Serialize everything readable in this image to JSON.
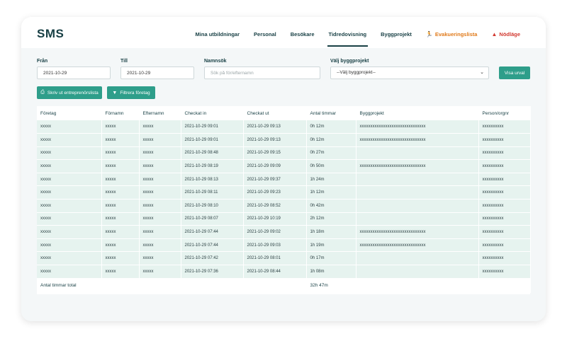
{
  "app": {
    "logo": "SMS"
  },
  "nav": {
    "items": [
      {
        "label": "Mina utbildningar"
      },
      {
        "label": "Personal"
      },
      {
        "label": "Besökare"
      },
      {
        "label": "Tidredovisning"
      },
      {
        "label": "Byggprojekt"
      },
      {
        "label": "Evakueringslista"
      },
      {
        "label": "Nödläge"
      }
    ],
    "active": "Tidredovisning"
  },
  "filters": {
    "from_label": "Från",
    "from_value": "2021-10-29",
    "to_label": "Till",
    "to_value": "2021-10-29",
    "name_label": "Namnsök",
    "name_placeholder": "Sök på för/efternamn",
    "project_label": "Välj byggprojekt",
    "project_selected": "--Välj byggprojekt--",
    "show_button": "Visa urval",
    "print_button": "Skriv ut entreprenörslista",
    "filter_button": "Filtrera företag"
  },
  "table": {
    "headers": [
      "Företag",
      "Förnamn",
      "Efternamn",
      "Checkat in",
      "Checkat ut",
      "Antal timmar",
      "Byggprojekt",
      "Person/orgnr"
    ],
    "rows": [
      [
        "xxxxx",
        "xxxxx",
        "xxxxx",
        "2021-10-29 09:01",
        "2021-10-29 09:13",
        "0h 12m",
        "xxxxxxxxxxxxxxxxxxxxxxxxxxxxxxx",
        "xxxxxxxxxx"
      ],
      [
        "xxxxx",
        "xxxxx",
        "xxxxx",
        "2021-10-29 09:01",
        "2021-10-29 09:13",
        "0h 12m",
        "xxxxxxxxxxxxxxxxxxxxxxxxxxxxxxx",
        "xxxxxxxxxx"
      ],
      [
        "xxxxx",
        "xxxxx",
        "xxxxx",
        "2021-10-29 08:48",
        "2021-10-29 09:15",
        "0h 27m",
        "",
        "xxxxxxxxxx"
      ],
      [
        "xxxxx",
        "xxxxx",
        "xxxxx",
        "2021-10-29 08:19",
        "2021-10-29 09:09",
        "0h 50m",
        "xxxxxxxxxxxxxxxxxxxxxxxxxxxxxxx",
        "xxxxxxxxxx"
      ],
      [
        "xxxxx",
        "xxxxx",
        "xxxxx",
        "2021-10-29 08:13",
        "2021-10-29 09:37",
        "1h 24m",
        "",
        "xxxxxxxxxx"
      ],
      [
        "xxxxx",
        "xxxxx",
        "xxxxx",
        "2021-10-29 08:11",
        "2021-10-29 09:23",
        "1h 12m",
        "",
        "xxxxxxxxxx"
      ],
      [
        "xxxxx",
        "xxxxx",
        "xxxxx",
        "2021-10-29 08:10",
        "2021-10-29 08:52",
        "0h 42m",
        "",
        "xxxxxxxxxx"
      ],
      [
        "xxxxx",
        "xxxxx",
        "xxxxx",
        "2021-10-29 08:07",
        "2021-10-29 10:19",
        "2h 12m",
        "",
        "xxxxxxxxxx"
      ],
      [
        "xxxxx",
        "xxxxx",
        "xxxxx",
        "2021-10-29 07:44",
        "2021-10-29 09:02",
        "1h 18m",
        "xxxxxxxxxxxxxxxxxxxxxxxxxxxxxxx",
        "xxxxxxxxxx"
      ],
      [
        "xxxxx",
        "xxxxx",
        "xxxxx",
        "2021-10-29 07:44",
        "2021-10-29 09:03",
        "1h 19m",
        "xxxxxxxxxxxxxxxxxxxxxxxxxxxxxxx",
        "xxxxxxxxxx"
      ],
      [
        "xxxxx",
        "xxxxx",
        "xxxxx",
        "2021-10-29 07:42",
        "2021-10-29 08:01",
        "0h 17m",
        "",
        "xxxxxxxxxx"
      ],
      [
        "xxxxx",
        "xxxxx",
        "xxxxx",
        "2021-10-29 07:36",
        "2021-10-29 08:44",
        "1h 08m",
        "",
        "xxxxxxxxxx"
      ]
    ],
    "footer_label": "Antal timmar total",
    "footer_total": "32h 47m"
  },
  "colors": {
    "accent": "#2e9e8a",
    "row": "#e6f3ef",
    "dark": "#173f44",
    "orange": "#e07a1a",
    "red": "#d23b32"
  },
  "icons": {
    "print": "print-icon",
    "filter": "filter-icon",
    "evac": "running-person-icon",
    "alert": "warning-icon",
    "select": "chevron-down-icon"
  }
}
